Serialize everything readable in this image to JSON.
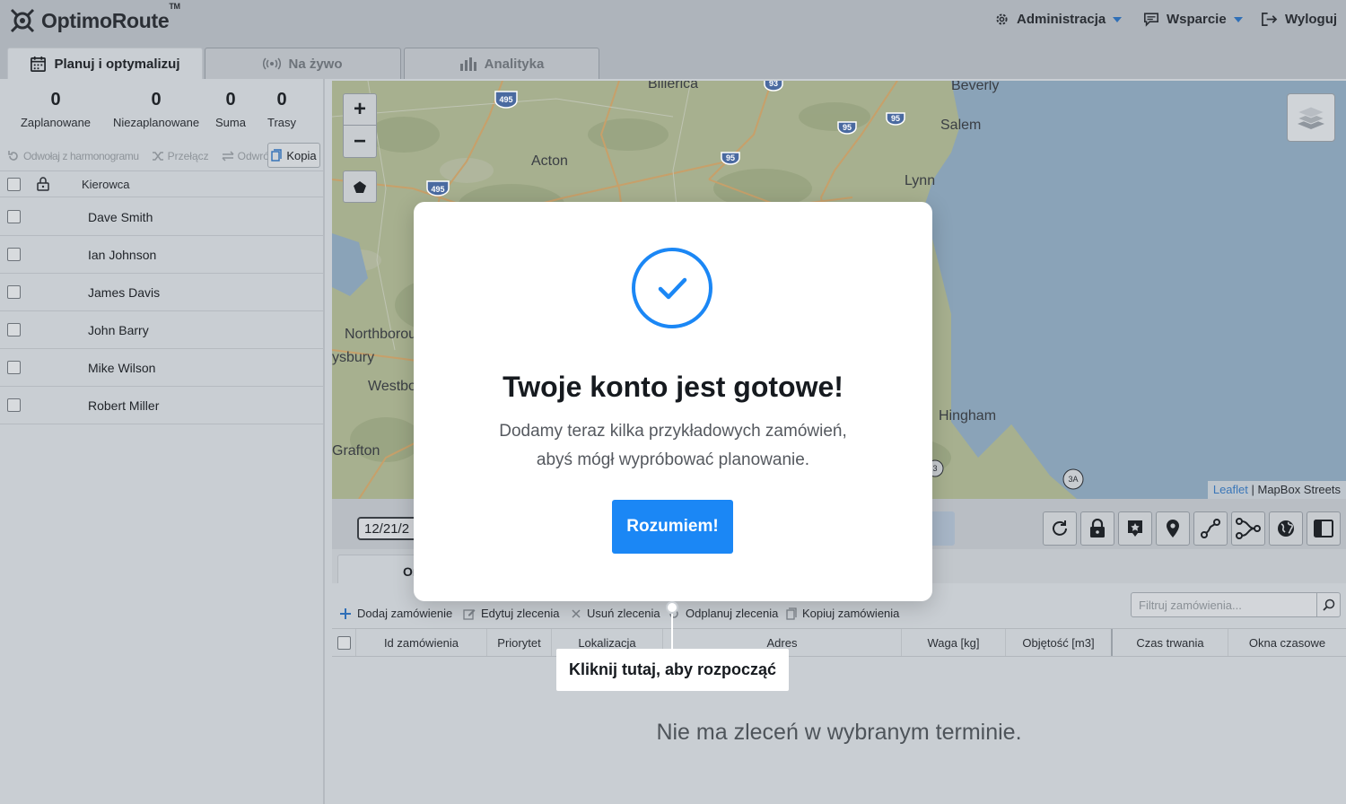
{
  "app": {
    "name": "OptimoRoute",
    "tm": "TM"
  },
  "header": {
    "menu": [
      {
        "label": "Administracja",
        "icon": "gear-icon",
        "dropdown": true
      },
      {
        "label": "Wsparcie",
        "icon": "chat-icon",
        "dropdown": true
      },
      {
        "label": "Wyloguj",
        "icon": "logout-icon",
        "dropdown": false
      }
    ]
  },
  "tabs": [
    {
      "label": "Planuj i optymalizuj",
      "icon": "calendar-icon",
      "active": true
    },
    {
      "label": "Na żywo",
      "icon": "broadcast-icon",
      "active": false
    },
    {
      "label": "Analityka",
      "icon": "bar-chart-icon",
      "active": false
    }
  ],
  "stats": [
    {
      "value": "0",
      "label": "Zaplanowane"
    },
    {
      "value": "0",
      "label": "Niezaplanowane"
    },
    {
      "value": "0",
      "label": "Suma"
    },
    {
      "value": "0",
      "label": "Trasy"
    }
  ],
  "driverActions": {
    "unschedule": "Odwołaj z harmonogramu",
    "switch": "Przełącz",
    "reverse": "Odwróć",
    "copy": "Kopia"
  },
  "drivers": {
    "columnHeader": "Kierowca",
    "rows": [
      "Dave Smith",
      "Ian Johnson",
      "James Davis",
      "John Barry",
      "Mike Wilson",
      "Robert Miller"
    ]
  },
  "map": {
    "places": [
      "Billerica",
      "Beverly",
      "Salem",
      "Acton",
      "Lynn",
      "Northborou",
      "ysbury",
      "Westbo",
      "Grafton",
      "Hingham"
    ],
    "shields": [
      "495",
      "93",
      "95",
      "95",
      "495",
      "95",
      "3A",
      "3"
    ],
    "zoomIn": "+",
    "zoomOut": "−",
    "attribution": {
      "leaflet": "Leaflet",
      "separator": " | ",
      "tiles": "MapBox Streets"
    }
  },
  "toolbar": {
    "date": "12/21/2"
  },
  "ordersTab": {
    "label": "Or"
  },
  "orderActions": {
    "add": "Dodaj zamówienie",
    "edit": "Edytuj zlecenia",
    "delete": "Usuń zlecenia",
    "unplan": "Odplanuj zlecenia",
    "copy": "Kopiuj zamówienia",
    "filterPlaceholder": "Filtruj zamówienia..."
  },
  "orderColumns": [
    "Id zamówienia",
    "Priorytet",
    "Lokalizacja",
    "Adres",
    "Waga [kg]",
    "Objętość [m3]",
    "Czas trwania",
    "Okna czasowe"
  ],
  "emptyMessage": "Nie ma zleceń w wybranym terminie.",
  "modal": {
    "title": "Twoje konto jest gotowe!",
    "line1": "Dodamy teraz kilka przykładowych zamówień,",
    "line2": "abyś mógł wypróbować planowanie.",
    "button": "Rozumiem!"
  },
  "hint": "Kliknij tutaj, aby rozpocząć",
  "colors": {
    "accent": "#1b87f5",
    "checkBlue": "#1b87f5",
    "water": "#8aa3b8",
    "land": "#a7b08f"
  }
}
